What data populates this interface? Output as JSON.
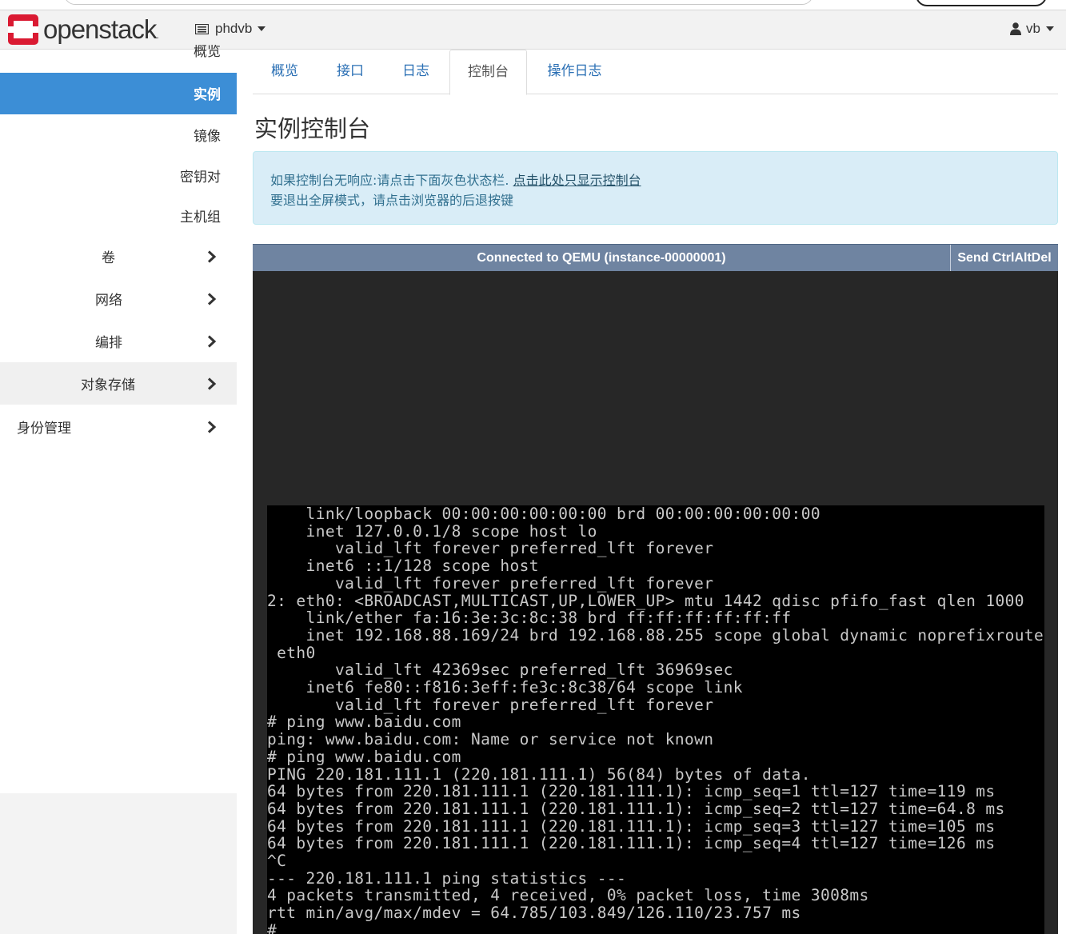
{
  "navbar": {
    "brand": "openstack",
    "brand_suffix": ".",
    "project": "phdvb",
    "user": "vb",
    "brand_color": "#da1a32"
  },
  "sidebar": {
    "overview_label": "概览",
    "active_label": "实例",
    "items": [
      "镜像",
      "密钥对",
      "主机组"
    ],
    "groups": [
      {
        "label": "卷"
      },
      {
        "label": "网络"
      },
      {
        "label": "编排"
      },
      {
        "label": "对象存储"
      },
      {
        "label": "身份管理"
      }
    ],
    "active_color": "#3c8ed6"
  },
  "tabs": [
    "概览",
    "接口",
    "日志",
    "控制台",
    "操作日志"
  ],
  "active_tab": "控制台",
  "page_title": "实例控制台",
  "alert": {
    "line1_text": "如果控制台无响应:请点击下面灰色状态栏.",
    "line1_link": "点击此处只显示控制台",
    "line2": "要退出全屏模式，请点击浏览器的后退按键"
  },
  "console": {
    "status": "Connected to QEMU (instance-00000001)",
    "send_button": "Send CtrlAltDel",
    "lines": [
      "    link/loopback 00:00:00:00:00:00 brd 00:00:00:00:00:00",
      "    inet 127.0.0.1/8 scope host lo",
      "       valid_lft forever preferred_lft forever",
      "    inet6 ::1/128 scope host",
      "       valid_lft forever preferred_lft forever",
      "2: eth0: <BROADCAST,MULTICAST,UP,LOWER_UP> mtu 1442 qdisc pfifo_fast qlen 1000",
      "    link/ether fa:16:3e:3c:8c:38 brd ff:ff:ff:ff:ff:ff",
      "    inet 192.168.88.169/24 brd 192.168.88.255 scope global dynamic noprefixroute",
      " eth0",
      "       valid_lft 42369sec preferred_lft 36969sec",
      "    inet6 fe80::f816:3eff:fe3c:8c38/64 scope link",
      "       valid_lft forever preferred_lft forever",
      "# ping www.baidu.com",
      "ping: www.baidu.com: Name or service not known",
      "# ping www.baidu.com",
      "PING 220.181.111.1 (220.181.111.1) 56(84) bytes of data.",
      "64 bytes from 220.181.111.1 (220.181.111.1): icmp_seq=1 ttl=127 time=119 ms",
      "64 bytes from 220.181.111.1 (220.181.111.1): icmp_seq=2 ttl=127 time=64.8 ms",
      "64 bytes from 220.181.111.1 (220.181.111.1): icmp_seq=3 ttl=127 time=105 ms",
      "64 bytes from 220.181.111.1 (220.181.111.1): icmp_seq=4 ttl=127 time=126 ms",
      "^C",
      "--- 220.181.111.1 ping statistics ---",
      "4 packets transmitted, 4 received, 0% packet loss, time 3008ms",
      "rtt min/avg/max/mdev = 64.785/103.849/126.110/23.757 ms",
      "# _"
    ]
  },
  "icons": {
    "project": "project-list-icon",
    "user": "user-icon",
    "chevron": "chevron-right-icon",
    "caret": "caret-down-icon"
  }
}
